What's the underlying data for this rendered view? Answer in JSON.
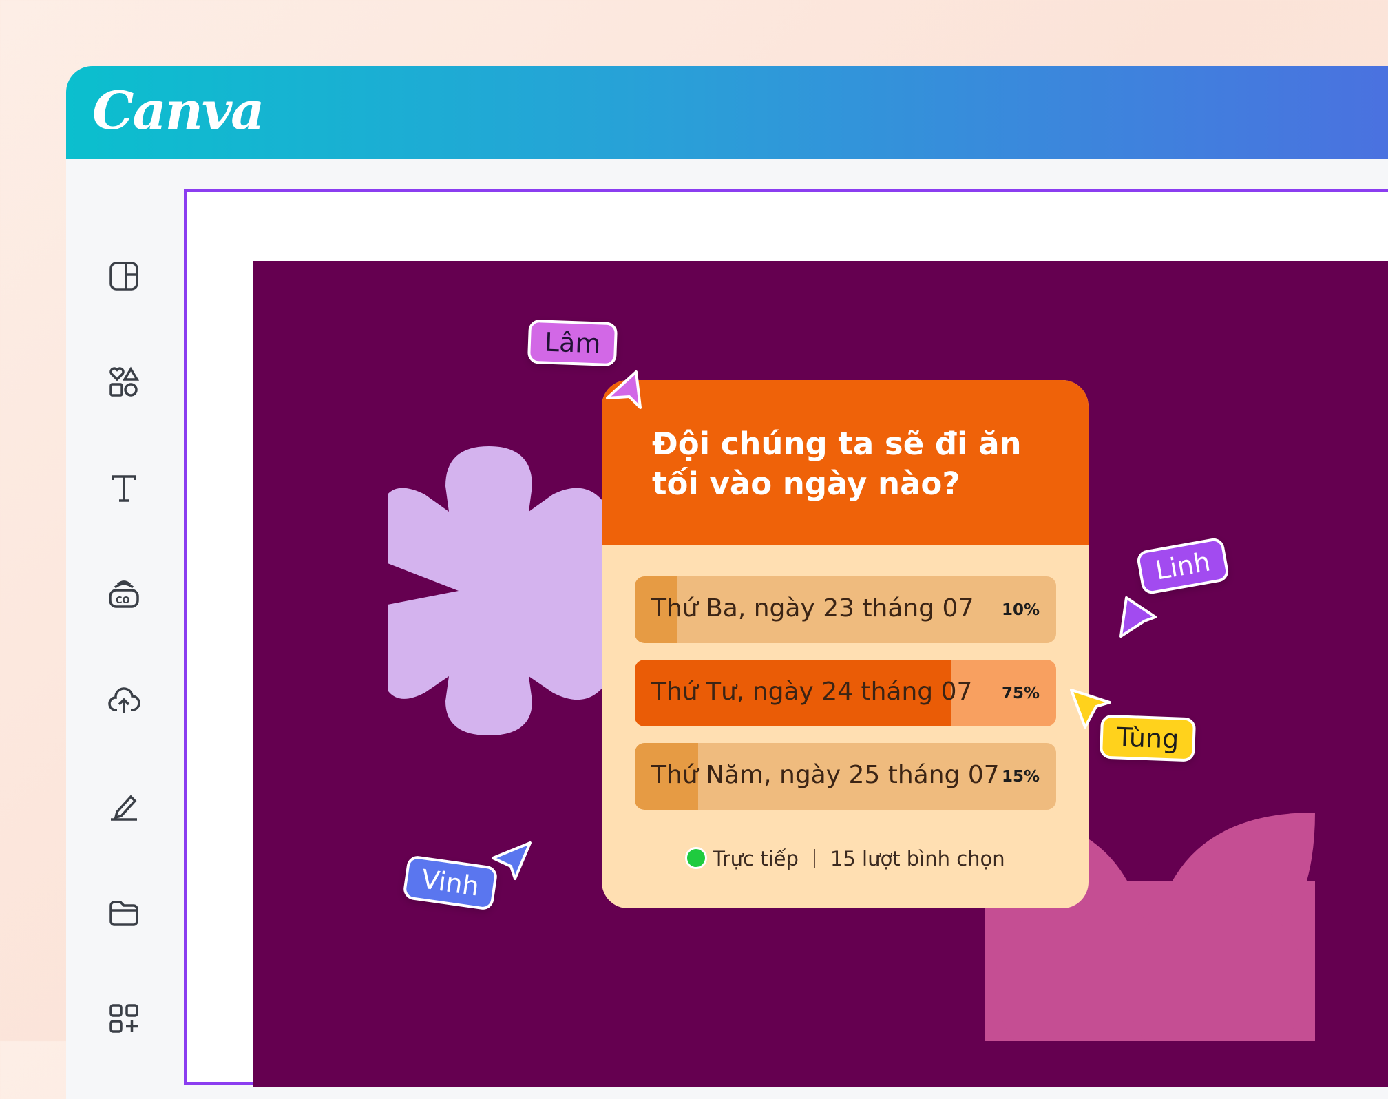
{
  "app": {
    "logo": "Canva",
    "brand_gradient": [
      "#0bbfce",
      "#4c6fe0"
    ]
  },
  "sidebar": {
    "items": [
      {
        "icon": "layout-icon"
      },
      {
        "icon": "elements-icon"
      },
      {
        "icon": "text-icon"
      },
      {
        "icon": "brand-icon"
      },
      {
        "icon": "upload-cloud-icon"
      },
      {
        "icon": "draw-icon"
      },
      {
        "icon": "folder-icon"
      },
      {
        "icon": "apps-icon"
      }
    ]
  },
  "poll": {
    "question": "Đội chúng ta sẽ đi ăn tối vào ngày nào?",
    "options": [
      {
        "label": "Thứ Ba, ngày 23 tháng 07",
        "percent_text": "10%",
        "value": 10,
        "highlight": false
      },
      {
        "label": "Thứ Tư, ngày 24 tháng 07",
        "percent_text": "75%",
        "value": 75,
        "highlight": true
      },
      {
        "label": "Thứ Năm, ngày 25 tháng 07",
        "percent_text": "15%",
        "value": 15,
        "highlight": false
      }
    ],
    "status": "Trực tiếp",
    "votes": "15 lượt bình chọn",
    "colors": {
      "header": "#ef6209",
      "body": "#ffdfb2",
      "bar": "#efbb7e",
      "bar_fill": "#e69b44",
      "bar_hl": "#f8a060",
      "bar_hl_fill": "#ea5c06"
    }
  },
  "collaborators": [
    {
      "name": "Lâm",
      "color": "#d268e6"
    },
    {
      "name": "Linh",
      "color": "#a24bf0"
    },
    {
      "name": "Tùng",
      "color": "#ffd21c"
    },
    {
      "name": "Vinh",
      "color": "#5a76ef"
    }
  ],
  "canvas": {
    "background": "#650050",
    "selection_color": "#8b3df0"
  }
}
